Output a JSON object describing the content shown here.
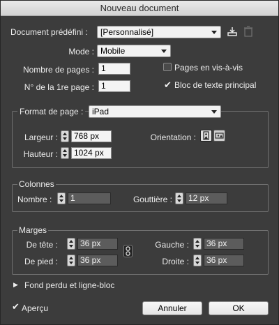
{
  "window": {
    "title": "Nouveau document"
  },
  "preset": {
    "label": "Document prédéfini :",
    "value": "[Personnalisé]"
  },
  "mode": {
    "label": "Mode :",
    "value": "Mobile"
  },
  "pages": {
    "label": "Nombre de pages :",
    "value": "1"
  },
  "first_page": {
    "label": "N° de la 1re page :",
    "value": "1"
  },
  "facing_pages": {
    "label": "Pages en vis-à-vis",
    "checked": false
  },
  "primary_text_frame": {
    "label": "Bloc de texte principal",
    "checked": true
  },
  "page_format": {
    "label": "Format de page :",
    "value": "iPad",
    "width_label": "Largeur :",
    "width": "768 px",
    "height_label": "Hauteur :",
    "height": "1024 px",
    "orientation_label": "Orientation :"
  },
  "columns": {
    "title": "Colonnes",
    "number_label": "Nombre :",
    "number": "1",
    "gutter_label": "Gouttière :",
    "gutter": "12 px"
  },
  "margins": {
    "title": "Marges",
    "top_label": "De tête :",
    "top": "36 px",
    "bottom_label": "De pied :",
    "bottom": "36 px",
    "left_label": "Gauche :",
    "left": "36 px",
    "right_label": "Droite :",
    "right": "36 px"
  },
  "bleed": {
    "label": "Fond perdu et ligne-bloc"
  },
  "preview": {
    "label": "Aperçu",
    "checked": true
  },
  "buttons": {
    "cancel": "Annuler",
    "ok": "OK"
  }
}
